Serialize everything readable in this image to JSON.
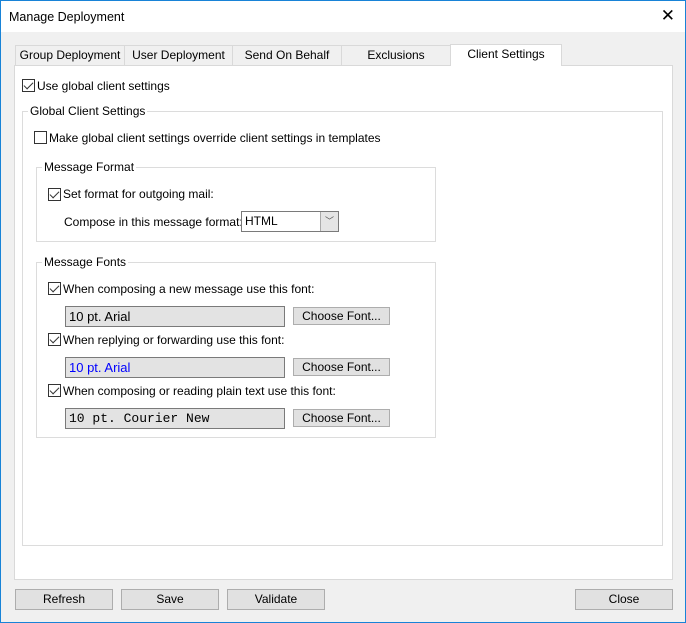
{
  "window": {
    "title": "Manage Deployment",
    "close_icon": "close-icon"
  },
  "tabs": [
    {
      "label": "Group Deployment"
    },
    {
      "label": "User Deployment"
    },
    {
      "label": "Send On Behalf"
    },
    {
      "label": "Exclusions"
    },
    {
      "label": "Client Settings",
      "selected": true
    }
  ],
  "client_settings": {
    "use_global": {
      "label": "Use global client settings",
      "checked": true
    },
    "global_group": {
      "legend": "Global Client Settings",
      "override": {
        "label": "Make global client settings override client settings in templates",
        "checked": false
      }
    },
    "message_format": {
      "legend": "Message Format",
      "set_format": {
        "label": "Set format for outgoing mail:",
        "checked": true
      },
      "compose_label": "Compose in this message format:",
      "format_value": "HTML"
    },
    "message_fonts": {
      "legend": "Message Fonts",
      "items": [
        {
          "label": "When composing a new message use this font:",
          "checked": true,
          "font": "10 pt. Arial",
          "font_color": "#000000",
          "button": "Choose Font..."
        },
        {
          "label": "When replying or forwarding use this font:",
          "checked": true,
          "font": "10 pt. Arial",
          "font_color": "#0000ff",
          "button": "Choose Font..."
        },
        {
          "label": "When composing or reading plain text use this font:",
          "checked": true,
          "font": "10 pt. Courier New",
          "font_color": "#000000",
          "button": "Choose Font..."
        }
      ]
    }
  },
  "footer": {
    "refresh": "Refresh",
    "save": "Save",
    "validate": "Validate",
    "close": "Close"
  }
}
